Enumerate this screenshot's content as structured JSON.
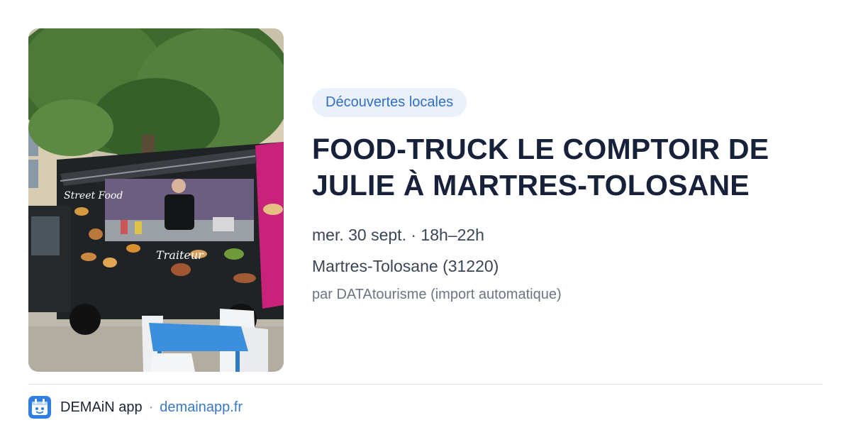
{
  "photo": {
    "alt_icon": "food-truck-photo",
    "menu_signs": [
      "Street Food",
      "Traiteur"
    ]
  },
  "tag": {
    "label": "Découvertes locales"
  },
  "event": {
    "title": "FOOD-TRUCK LE COMPTOIR DE JULIE À MARTRES-TOLOSANE",
    "date": "mer. 30 sept. · 18h–22h",
    "place": "Martres-Tolosane (31220)",
    "source": "par DATAtourisme (import automatique)"
  },
  "footer": {
    "app_name": "DEMAiN app",
    "separator": "·",
    "link": "demainapp.fr",
    "icon": "demain-app-icon"
  },
  "colors": {
    "accent": "#2f6fc4",
    "tag_bg": "#eaf1fb",
    "title": "#17223a",
    "muted": "#6b7585",
    "divider": "#dde3e8"
  }
}
